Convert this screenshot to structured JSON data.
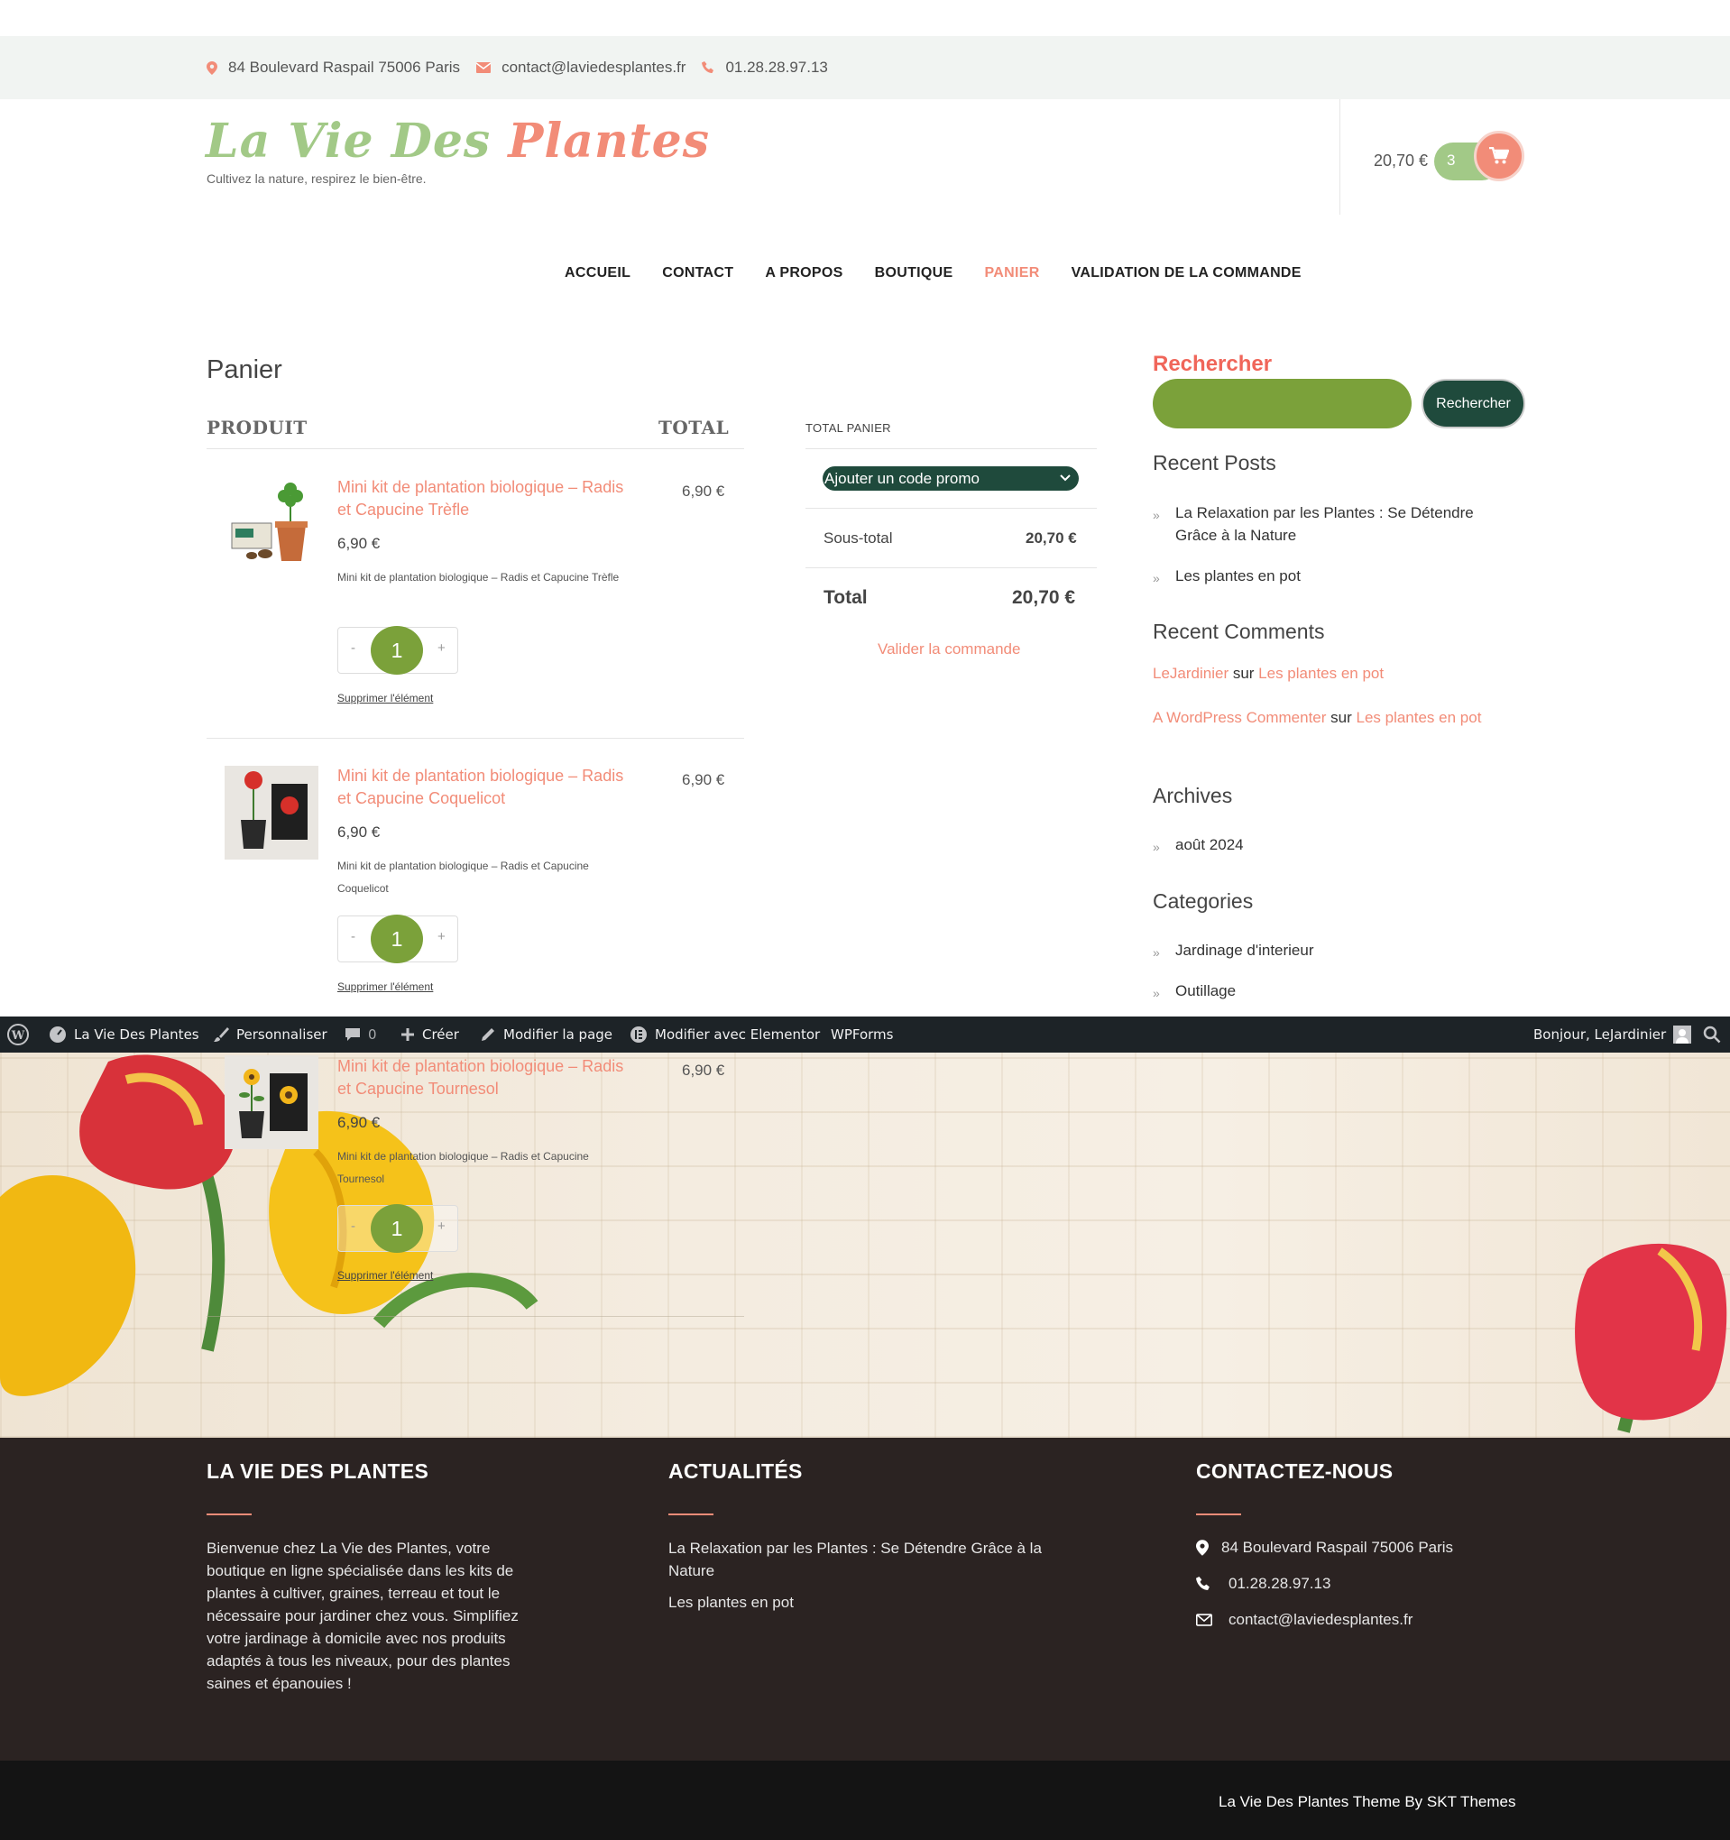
{
  "topbar": {
    "address": "84 Boulevard Raspail 75006 Paris",
    "email": "contact@laviedesplantes.fr",
    "phone": "01.28.28.97.13"
  },
  "header": {
    "logo_part1": "La Vie Des ",
    "logo_part2": "Plantes",
    "tagline": "Cultivez la nature, respirez le bien-être.",
    "cart_total": "20,70 €",
    "cart_count": "3"
  },
  "nav": {
    "items": [
      "ACCUEIL",
      "CONTACT",
      "A PROPOS",
      "BOUTIQUE",
      "PANIER",
      "VALIDATION DE LA COMMANDE"
    ],
    "active": "PANIER"
  },
  "cart": {
    "title": "Panier",
    "col_product": "PRODUIT",
    "col_total": "TOTAL",
    "items": [
      {
        "name": "Mini kit de plantation biologique – Radis et Capucine Trèfle",
        "price": "6,90 €",
        "description": "Mini kit de plantation biologique – Radis et Capucine Trèfle",
        "quantity": "1",
        "line_total": "6,90 €",
        "remove": "Supprimer l'élément",
        "minus": "-",
        "plus": "+"
      },
      {
        "name": "Mini kit de plantation biologique – Radis et Capucine Coquelicot",
        "price": "6,90 €",
        "description": "Mini kit de plantation biologique – Radis et Capucine Coquelicot",
        "quantity": "1",
        "line_total": "6,90 €",
        "remove": "Supprimer l'élément",
        "minus": "-",
        "plus": "+"
      },
      {
        "name": "Mini kit de plantation biologique – Radis et Capucine Tournesol",
        "price": "6,90 €",
        "description": "Mini kit de plantation biologique – Radis et Capucine Tournesol",
        "quantity": "1",
        "line_total": "6,90 €",
        "remove": "Supprimer l'élément",
        "minus": "-",
        "plus": "+"
      }
    ]
  },
  "totals": {
    "title": "TOTAL PANIER",
    "coupon": "Ajouter un code promo",
    "subtotal_label": "Sous-total",
    "subtotal": "20,70 €",
    "total_label": "Total",
    "total": "20,70 €",
    "checkout": "Valider la commande"
  },
  "sidebar": {
    "search_title": "Rechercher",
    "search_button": "Rechercher",
    "recent_posts_title": "Recent Posts",
    "recent_posts": [
      "La Relaxation par les Plantes : Se Détendre Grâce à la Nature",
      "Les plantes en pot"
    ],
    "recent_comments_title": "Recent Comments",
    "recent_comments": [
      {
        "author": "LeJardinier",
        "sep": " sur ",
        "post": "Les plantes en pot"
      },
      {
        "author": "A WordPress Commenter",
        "sep": " sur ",
        "post": "Les plantes en pot"
      }
    ],
    "archives_title": "Archives",
    "archives": [
      "août 2024"
    ],
    "categories_title": "Categories",
    "categories": [
      "Jardinage d'interieur",
      "Outillage"
    ]
  },
  "adminbar": {
    "site": "La Vie Des Plantes",
    "customize": "Personnaliser",
    "comments": "0",
    "create": "Créer",
    "edit_page": "Modifier la page",
    "elementor": "Modifier avec Elementor",
    "wpforms": "WPForms",
    "greeting": "Bonjour, LeJardinier"
  },
  "footer": {
    "col1_title": "LA VIE DES PLANTES",
    "col1_text": "Bienvenue chez La Vie des Plantes, votre boutique en ligne spécialisée dans les kits de plantes à cultiver, graines, terreau et tout le nécessaire pour jardiner chez vous. Simplifiez votre jardinage à domicile avec nos produits adaptés à tous les niveaux, pour des plantes saines et épanouies !",
    "col2_title": "ACTUALITÉS",
    "col2_links": [
      "La Relaxation par les Plantes : Se Détendre Grâce à la Nature",
      "Les plantes en pot"
    ],
    "col3_title": "CONTACTEZ-NOUS",
    "address": "84 Boulevard Raspail 75006 Paris",
    "phone": "01.28.28.97.13",
    "email": "contact@laviedesplantes.fr",
    "copyright": "La Vie Des Plantes Theme By SKT Themes"
  },
  "colors": {
    "accent": "#f28c78",
    "green": "#7ba13a",
    "dark_green": "#1f4a3c",
    "logo_green": "#a2c987",
    "footer_bg": "#2b2322"
  }
}
